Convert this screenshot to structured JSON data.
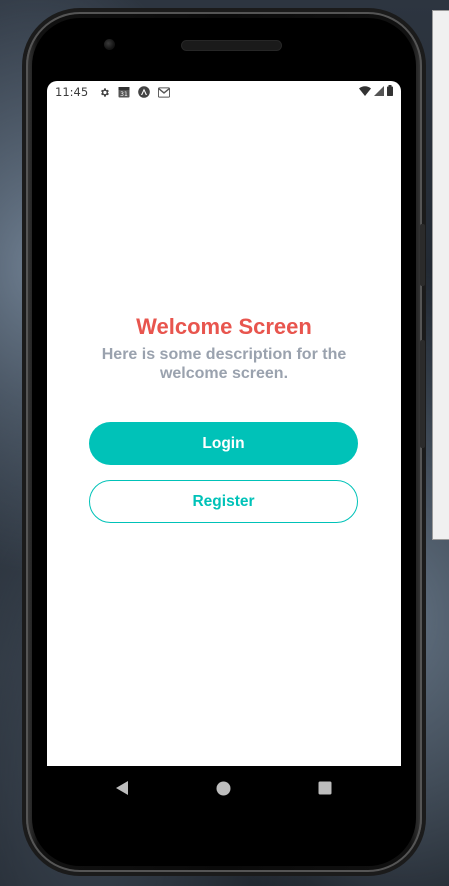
{
  "status_bar": {
    "time": "11:45",
    "calendar_day": "31",
    "icons": [
      "gear-icon",
      "calendar-icon",
      "alert-icon",
      "gmail-icon",
      "wifi-icon",
      "signal-icon",
      "battery-icon"
    ]
  },
  "welcome": {
    "title": "Welcome Screen",
    "description": "Here is some description for the welcome screen."
  },
  "buttons": {
    "login_label": "Login",
    "register_label": "Register"
  },
  "nav": {
    "icons": [
      "back-icon",
      "home-icon",
      "recents-icon"
    ]
  },
  "colors": {
    "accent": "#00c2b8",
    "title": "#e8554e",
    "description": "#9aa2ae",
    "screen_background": "#ffffff"
  }
}
